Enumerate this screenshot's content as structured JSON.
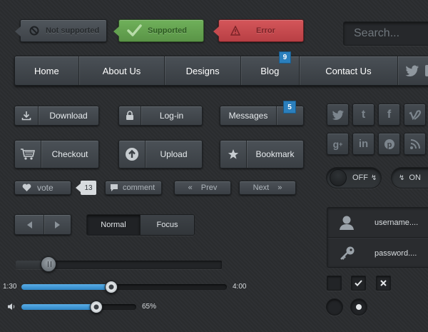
{
  "alerts": {
    "not_supported": "Not supported",
    "supported": "Supported",
    "error": "Error"
  },
  "search": {
    "placeholder": "Search..."
  },
  "nav": {
    "items": [
      "Home",
      "About Us",
      "Designs",
      "Blog",
      "Contact Us"
    ],
    "blog_badge": "9"
  },
  "buttons": {
    "download": "Download",
    "login": "Log-in",
    "messages": "Messages",
    "messages_badge": "5",
    "checkout": "Checkout",
    "upload": "Upload",
    "bookmark": "Bookmark",
    "vote": "vote",
    "vote_count": "13",
    "comment": "comment",
    "prev": "Prev",
    "next": "Next",
    "normal": "Normal",
    "focus": "Focus"
  },
  "toggles": {
    "off": "OFF",
    "on": "ON"
  },
  "login_form": {
    "username_placeholder": "username....",
    "password_placeholder": "password...."
  },
  "media": {
    "slider_level": 0.16,
    "elapsed": "1:30",
    "duration": "4:00",
    "progress": 0.4375,
    "volume_label": "65%",
    "volume": 0.65
  },
  "social_icons": [
    "twitter-icon",
    "tumblr-icon",
    "facebook-icon",
    "vimeo-icon",
    "google-plus-icon",
    "linkedin-icon",
    "pinterest-icon",
    "rss-icon"
  ],
  "colors": {
    "supported": "#5f9e4c",
    "error": "#c0454a",
    "accent": "#2f86c5",
    "badge": "#2b7fbd"
  }
}
